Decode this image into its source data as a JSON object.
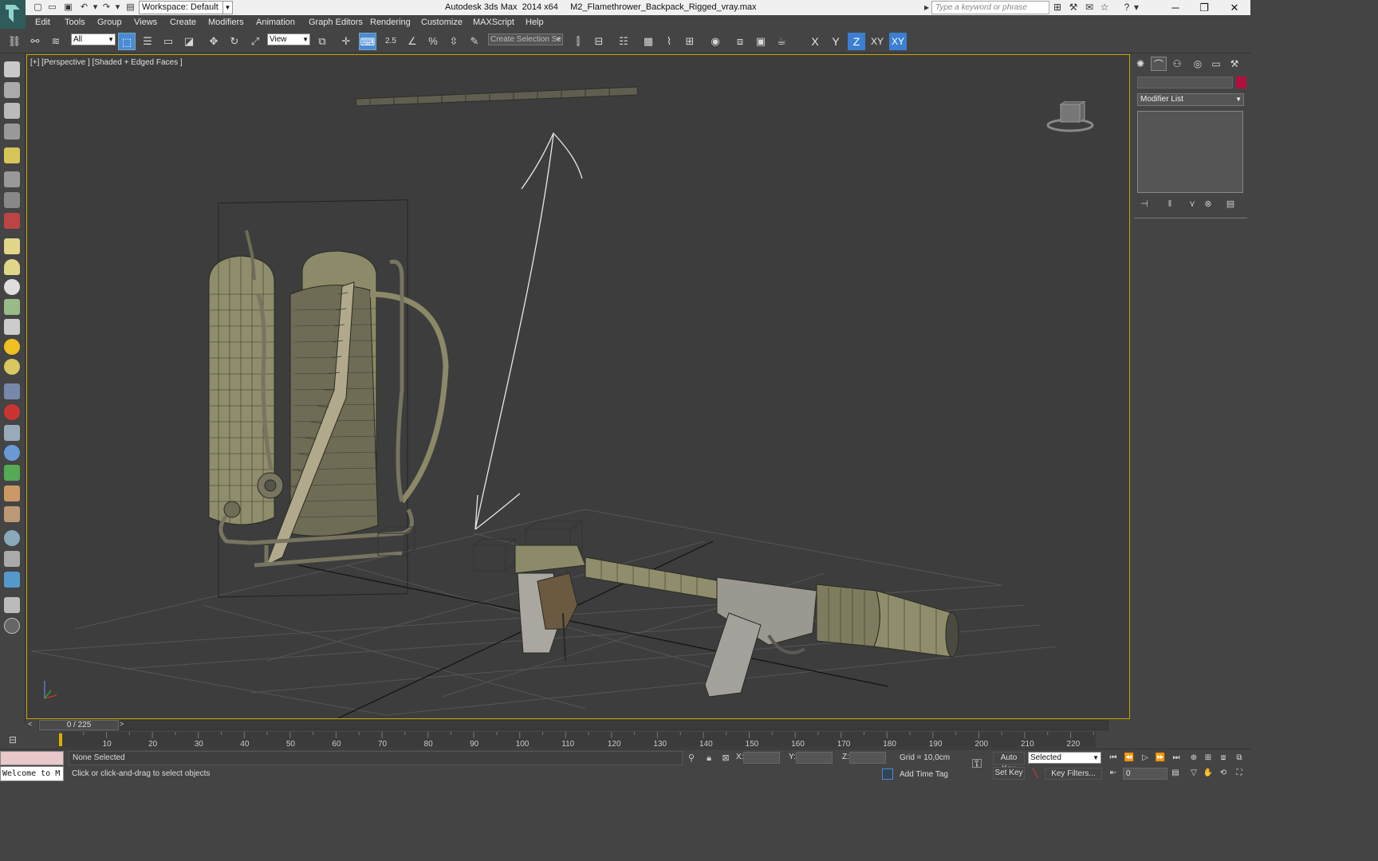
{
  "window": {
    "app_title": "Autodesk 3ds Max  2014 x64     M2_Flamethrower_Backpack_Rigged_vray.max",
    "workspace_label": "Workspace: Default",
    "search_placeholder": "Type a keyword or phrase"
  },
  "menu": {
    "items": [
      "Edit",
      "Tools",
      "Group",
      "Views",
      "Create",
      "Modifiers",
      "Animation",
      "Graph Editors",
      "Rendering",
      "Customize",
      "MAXScript",
      "Help"
    ]
  },
  "toolbar": {
    "selection_filter": "All",
    "reference_coord": "View",
    "snap_label": "2.5",
    "selection_set_placeholder": "Create Selection Se",
    "axis": {
      "x": "X",
      "y": "Y",
      "z": "Z",
      "xy": "XY",
      "xy_alt": "XY"
    }
  },
  "viewport": {
    "label": "[+] [Perspective ] [Shaded + Edged Faces ]"
  },
  "command_panel": {
    "modifier_list": "Modifier List",
    "object_color": "#b0103c"
  },
  "timeline": {
    "frame_indicator": "0 / 225",
    "ticks": [
      "10",
      "20",
      "30",
      "40",
      "50",
      "60",
      "70",
      "80",
      "90",
      "100",
      "110",
      "120",
      "130",
      "140",
      "150",
      "160",
      "170",
      "180",
      "190",
      "200",
      "210",
      "220"
    ]
  },
  "status": {
    "listener_text": "Welcome to M",
    "selection": "None Selected",
    "prompt": "Click or click-and-drag to select objects",
    "x_label": "X:",
    "y_label": "Y:",
    "z_label": "Z:",
    "grid": "Grid = 10,0cm",
    "add_time_tag": "Add Time Tag",
    "auto_key": "Auto Key",
    "set_key": "Set Key",
    "selected_option": "Selected",
    "key_filters": "Key Filters...",
    "current_frame": "0"
  },
  "colors": {
    "viewport_bg": "#3d3d3d",
    "active_viewport_border": "#c8a200",
    "accent": "#4b8bd4"
  }
}
